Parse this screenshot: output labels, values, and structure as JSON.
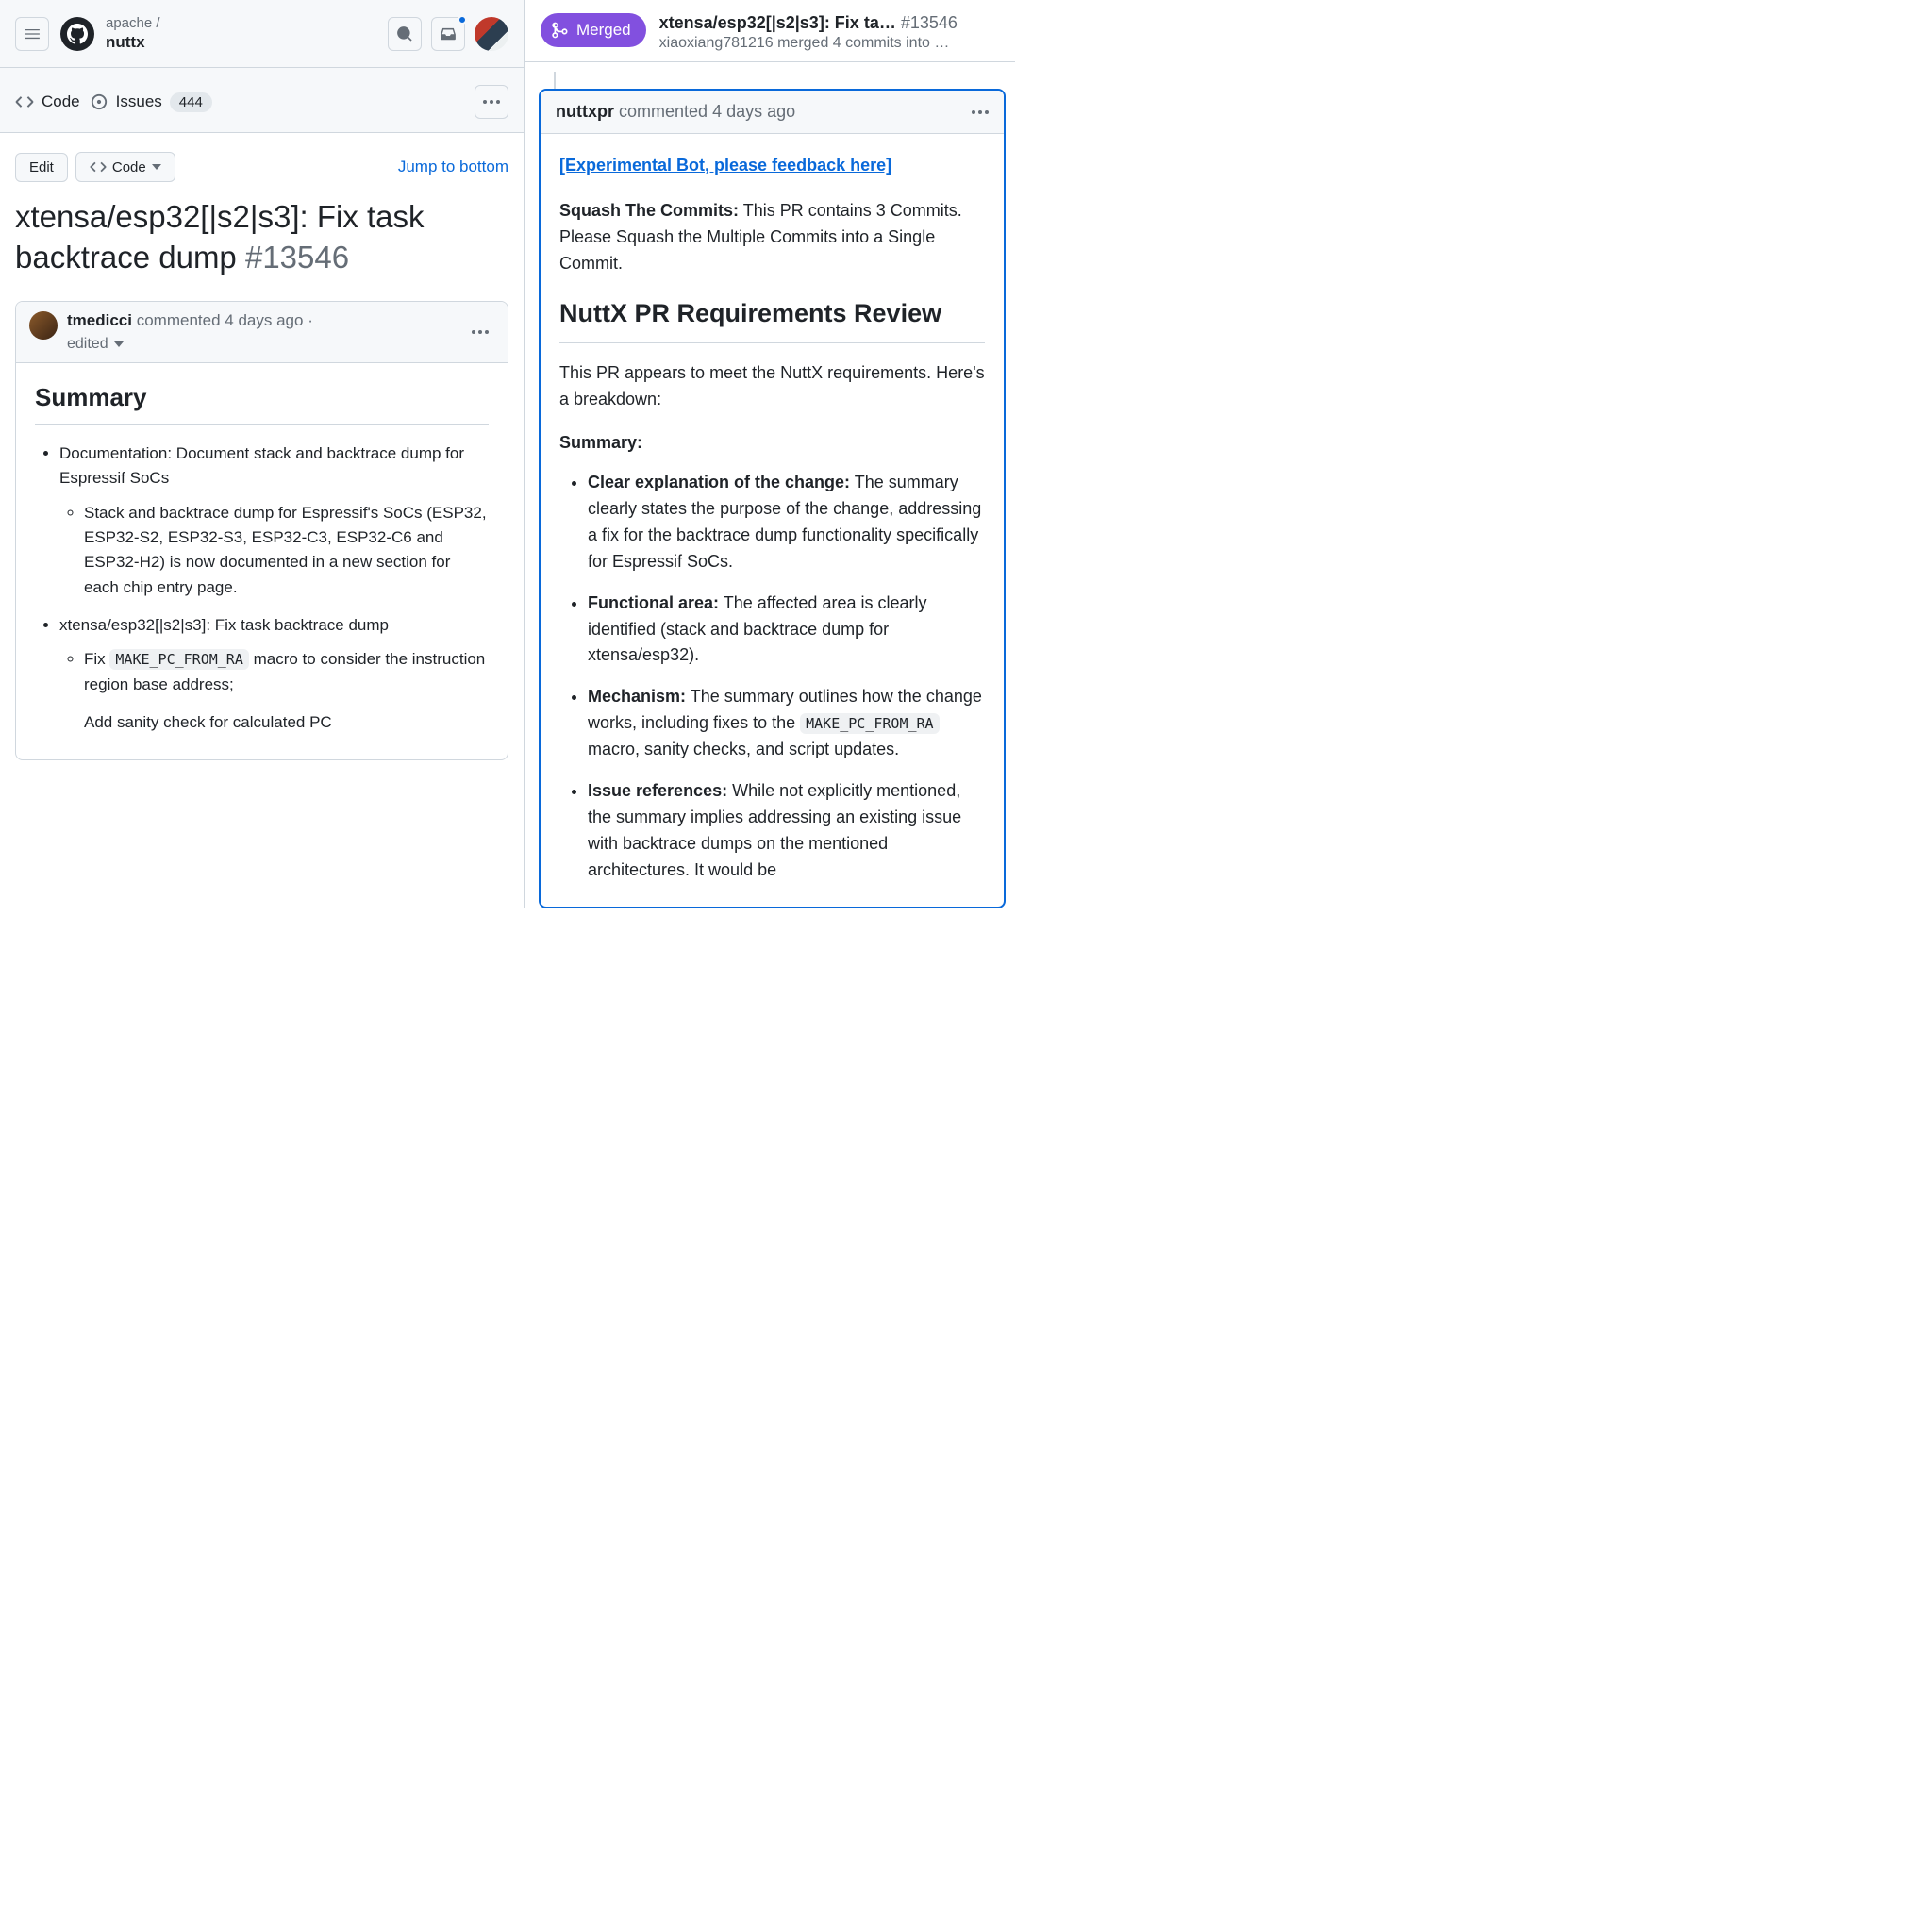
{
  "header": {
    "owner": "apache /",
    "repo": "nuttx"
  },
  "repoNav": {
    "code": "Code",
    "issues": "Issues",
    "issuesCount": "444"
  },
  "toolbar": {
    "edit": "Edit",
    "code": "Code",
    "jump": "Jump to bottom"
  },
  "pr": {
    "title": "xtensa/esp32[|s2|s3]: Fix task backtrace dump",
    "number": "#13546"
  },
  "comment1": {
    "author": "tmedicci",
    "verb": "commented",
    "time": "4 days ago",
    "editedDot": "·",
    "edited": "edited",
    "h2": "Summary",
    "bullets": {
      "doc": "Documentation: Document stack and backtrace dump for Espressif SoCs",
      "docSub": "Stack and backtrace dump for Espressif's SoCs (ESP32, ESP32-S2, ESP32-S3, ESP32-C3, ESP32-C6 and ESP32-H2) is now documented in a new section for each chip entry page.",
      "fix": "xtensa/esp32[|s2|s3]: Fix task backtrace dump",
      "fixSub1a": "Fix ",
      "fixSub1code": "MAKE_PC_FROM_RA",
      "fixSub1b": " macro to consider the instruction region base address;",
      "fixSub2": "Add sanity check for calculated PC"
    }
  },
  "right": {
    "badge": "Merged",
    "title": "xtensa/esp32[|s2|s3]: Fix ta…",
    "number": "#13546",
    "mergedBy": "xiaoxiang781216",
    "mergedRest": " merged 4 commits into …"
  },
  "comment2": {
    "author": "nuttxpr",
    "verb": "commented",
    "time": "4 days ago",
    "botLink": "[Experimental Bot, please feedback here]",
    "squashLabel": "Squash The Commits:",
    "squashText": " This PR contains 3 Commits. Please Squash the Multiple Commits into a Single Commit.",
    "reviewHeading": "NuttX PR Requirements Review",
    "intro": "This PR appears to meet the NuttX requirements. Here's a breakdown:",
    "summaryLabel": "Summary:",
    "items": {
      "i1b": "Clear explanation of the change:",
      "i1": " The summary clearly states the purpose of the change, addressing a fix for the backtrace dump functionality specifically for Espressif SoCs.",
      "i2b": "Functional area:",
      "i2": " The affected area is clearly identified (stack and backtrace dump for xtensa/esp32).",
      "i3b": "Mechanism:",
      "i3a": " The summary outlines how the change works, including fixes to the ",
      "i3code": "MAKE_PC_FROM_RA",
      "i3c": " macro, sanity checks, and script updates.",
      "i4b": "Issue references:",
      "i4": " While not explicitly mentioned, the summary implies addressing an existing issue with backtrace dumps on the mentioned architectures. It would be"
    }
  }
}
